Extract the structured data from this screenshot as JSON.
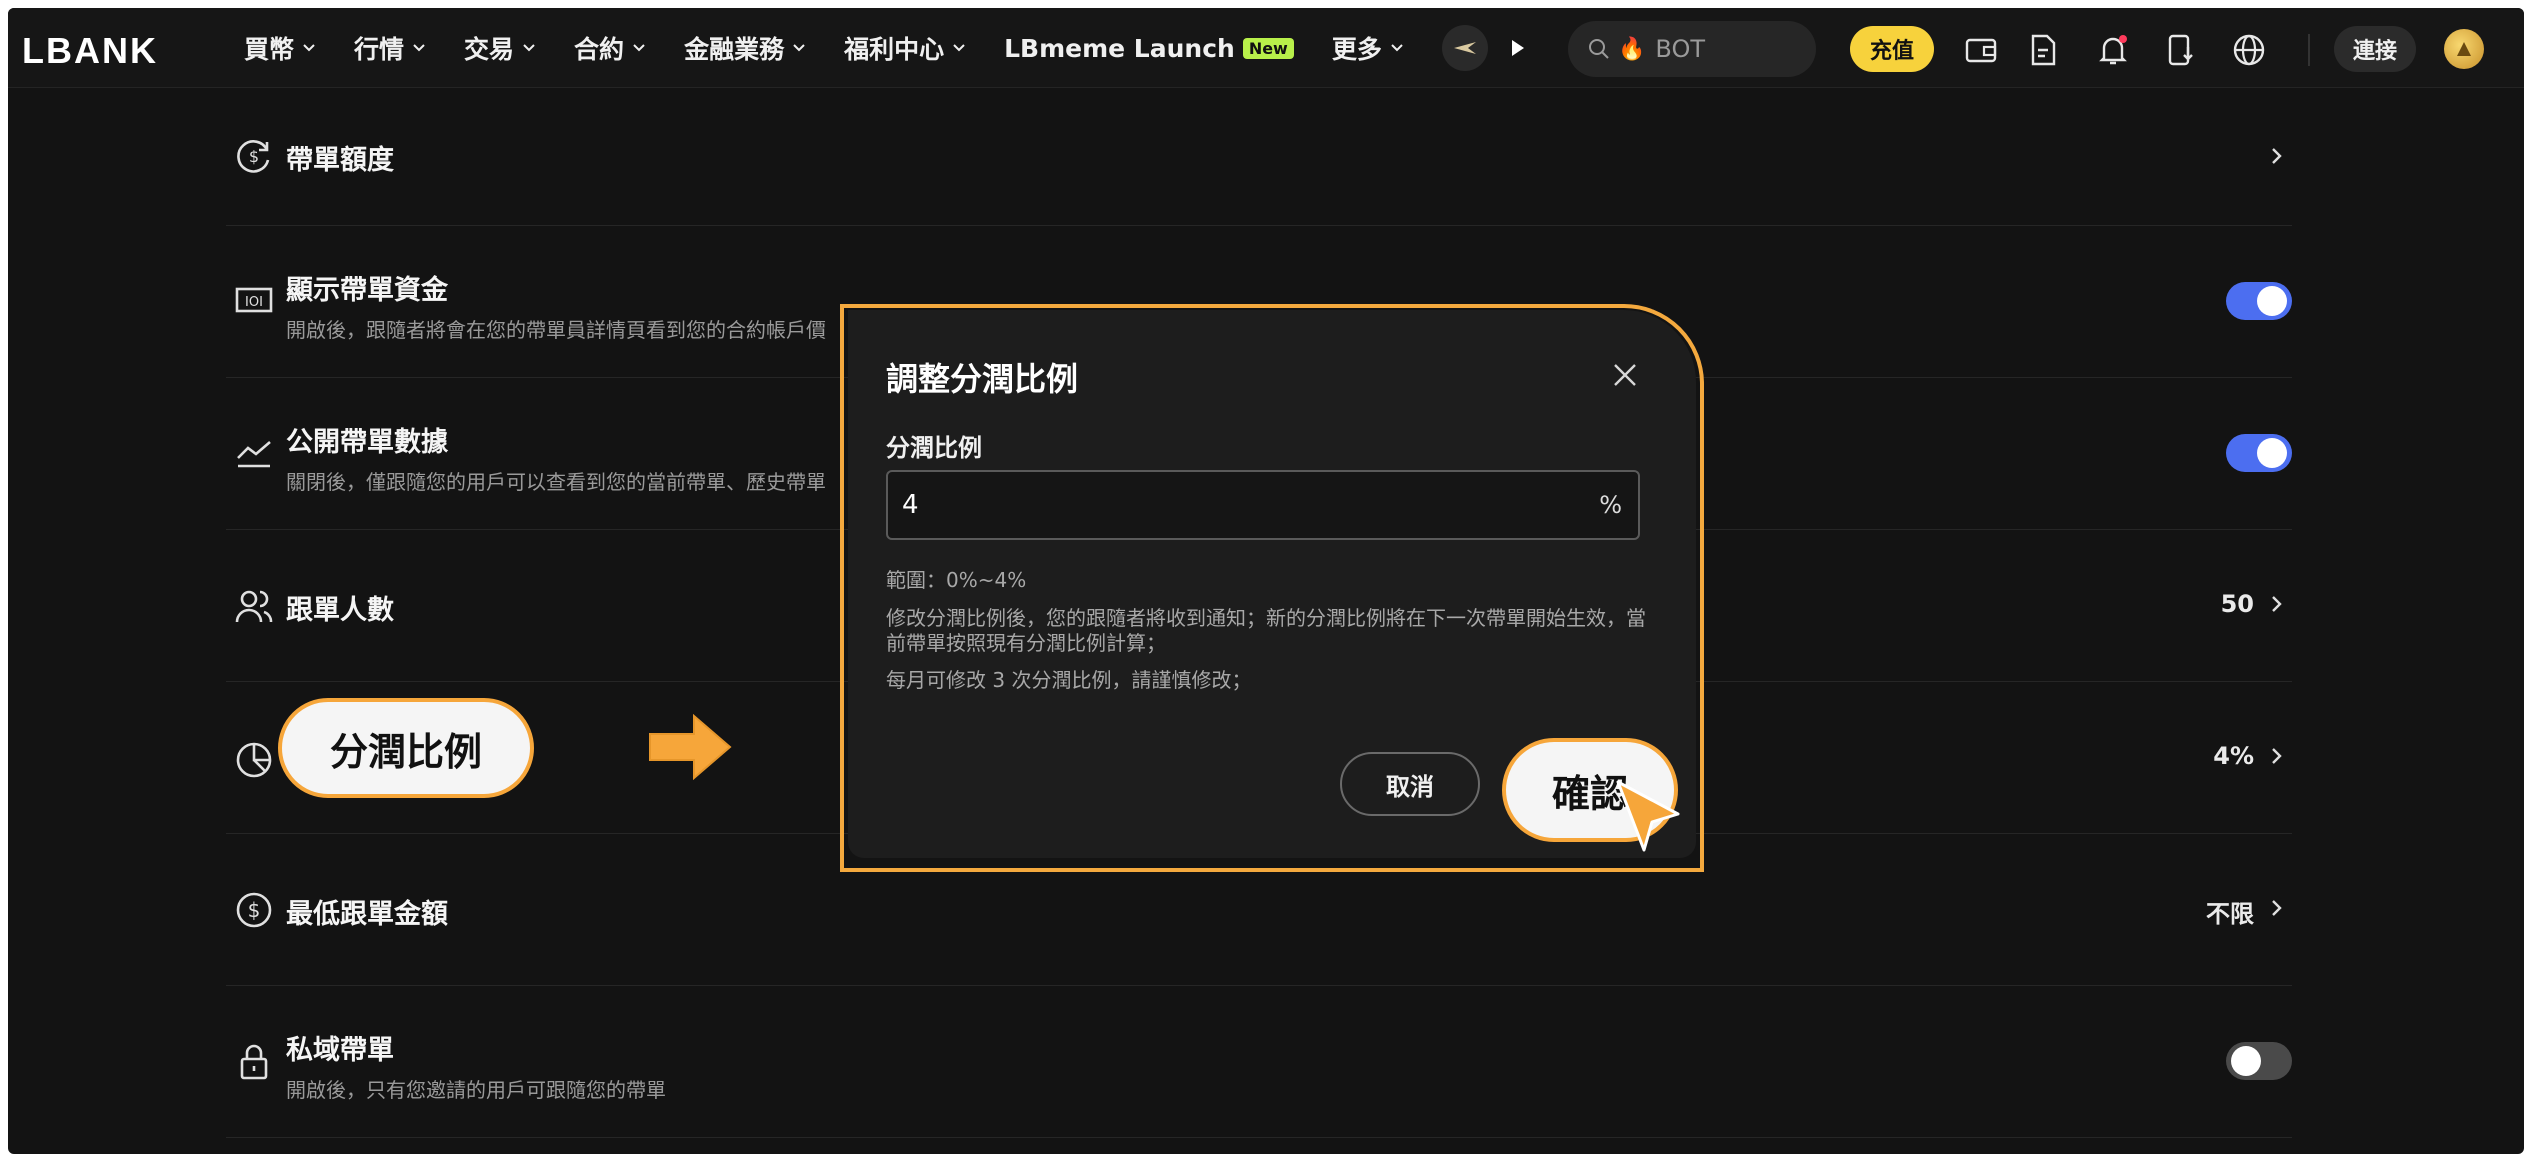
{
  "nav": {
    "logo": "LBANK",
    "menu": [
      "買幣",
      "行情",
      "交易",
      "合約",
      "金融業務",
      "福利中心"
    ],
    "launch_label": "LBmeme Launch",
    "new_badge": "New",
    "more_label": "更多",
    "search_placeholder": "BOT",
    "deposit_label": "充值",
    "connect_label": "連接"
  },
  "settings": [
    {
      "title": "帶單額度",
      "desc": "",
      "value": "",
      "control": "chevron",
      "icon": "refresh-dollar-icon"
    },
    {
      "title": "顯示帶單資金",
      "desc": "開啟後，跟隨者將會在您的帶單員詳情頁看到您的合約帳戶價",
      "value": "",
      "control": "toggle-on",
      "icon": "money-bill-icon"
    },
    {
      "title": "公開帶單數據",
      "desc": "關閉後，僅跟隨您的用戶可以查看到您的當前帶單、歷史帶單",
      "value": "",
      "control": "toggle-on",
      "icon": "chart-line-icon"
    },
    {
      "title": "跟單人數",
      "desc": "",
      "value": "50",
      "control": "chevron",
      "icon": "users-icon"
    },
    {
      "title": "",
      "desc": "",
      "value": "4%",
      "control": "chevron",
      "icon": "pie-chart-icon"
    },
    {
      "title": "最低跟單金額",
      "desc": "",
      "value": "不限",
      "control": "chevron",
      "icon": "dollar-circle-icon"
    },
    {
      "title": "私域帶單",
      "desc": "開啟後，只有您邀請的用戶可跟隨您的帶單",
      "value": "",
      "control": "toggle-off",
      "icon": "lock-icon"
    }
  ],
  "callout_label": "分潤比例",
  "modal": {
    "title": "調整分潤比例",
    "field_label": "分潤比例",
    "field_value": "4",
    "field_unit": "%",
    "range_note": "範圍：0%~4%",
    "notice_1": "修改分潤比例後，您的跟隨者將收到通知；新的分潤比例將在下一次帶單開始生效，當前帶單按照現有分潤比例計算；",
    "notice_2": "每月可修改 3 次分潤比例，請謹慎修改；",
    "cancel_label": "取消",
    "confirm_label": "確認"
  },
  "colors": {
    "background": "#131313",
    "highlight": "#f6a63a",
    "toggle_on": "#4c6ef0",
    "deposit": "#f7d23c"
  }
}
